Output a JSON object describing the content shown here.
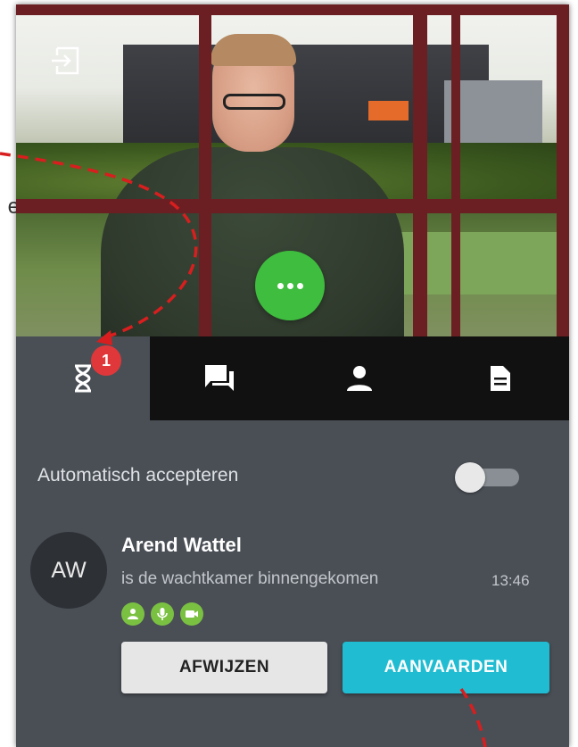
{
  "left_edge_fragment": "e",
  "video": {
    "exit_icon": "exit-to-app-icon",
    "more_button_icon": "more-horizontal-icon",
    "more_button_color": "#3ebd3e"
  },
  "tabs": [
    {
      "name": "waiting-room",
      "icon": "hourglass-icon",
      "active": true,
      "badge": "1"
    },
    {
      "name": "chat",
      "icon": "chat-icon",
      "active": false
    },
    {
      "name": "participants",
      "icon": "person-icon",
      "active": false
    },
    {
      "name": "documents",
      "icon": "document-icon",
      "active": false
    }
  ],
  "auto_accept": {
    "label": "Automatisch accepteren",
    "enabled": false
  },
  "request": {
    "avatar_initials": "AW",
    "name": "Arend Wattel",
    "status": "is de wachtkamer binnengekomen",
    "time": "13:46",
    "capability_icons": [
      "person-icon",
      "microphone-icon",
      "camera-icon"
    ],
    "capability_color": "#7ac142"
  },
  "actions": {
    "reject_label": "AFWIJZEN",
    "accept_label": "AANVAARDEN",
    "accept_color": "#20bcd2"
  },
  "colors": {
    "panel_bg": "#4a4f56",
    "tabbar_bg": "#111111",
    "badge": "#e0383a",
    "annotation_line": "#d81e1e"
  }
}
